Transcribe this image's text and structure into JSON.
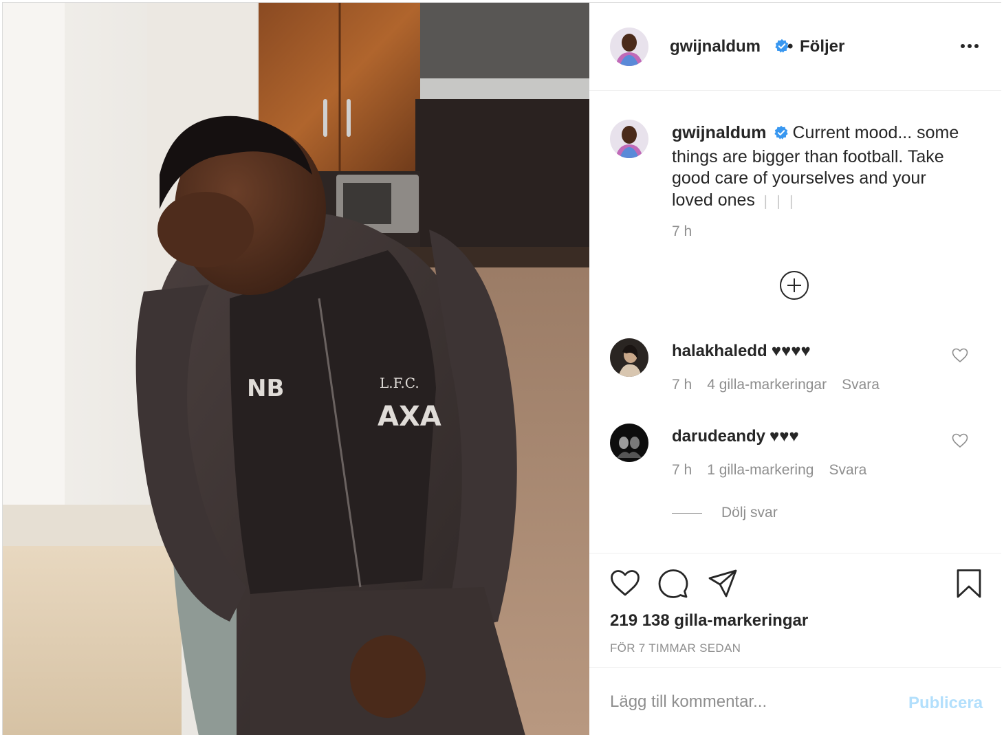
{
  "post": {
    "author": {
      "username": "gwijnaldum",
      "verified": true,
      "follow_separator": "•",
      "follow_status": "Följer"
    },
    "caption": {
      "username": "gwijnaldum",
      "text": "Current mood... some things are bigger than football. Take good care of yourselves and your loved ones",
      "emoji": "❘❘❘",
      "time": "7 h"
    },
    "comments": [
      {
        "username": "halakhaledd",
        "text": "♥♥♥♥",
        "time": "7 h",
        "likes": "4 gilla-markeringar",
        "reply": "Svara"
      },
      {
        "username": "darudeandy",
        "text": "♥♥♥",
        "time": "7 h",
        "likes": "1 gilla-markering",
        "reply": "Svara"
      }
    ],
    "hide_replies": "Dölj svar",
    "like_count": "219 138 gilla-markeringar",
    "posted": "FÖR 7 TIMMAR SEDAN",
    "add_comment": {
      "placeholder": "Lägg till kommentar...",
      "publish_label": "Publicera"
    },
    "icons": {
      "more": "more-options-icon",
      "verified": "verified-badge-icon",
      "load_more": "plus-circle-icon",
      "like": "heart-icon",
      "comment": "comment-bubble-icon",
      "share": "paper-plane-icon",
      "save": "bookmark-icon"
    },
    "colors": {
      "verified": "#3897f0",
      "publish_disabled": "#b2dffc",
      "secondary_text": "#8e8e8e",
      "primary_text": "#262626"
    }
  }
}
